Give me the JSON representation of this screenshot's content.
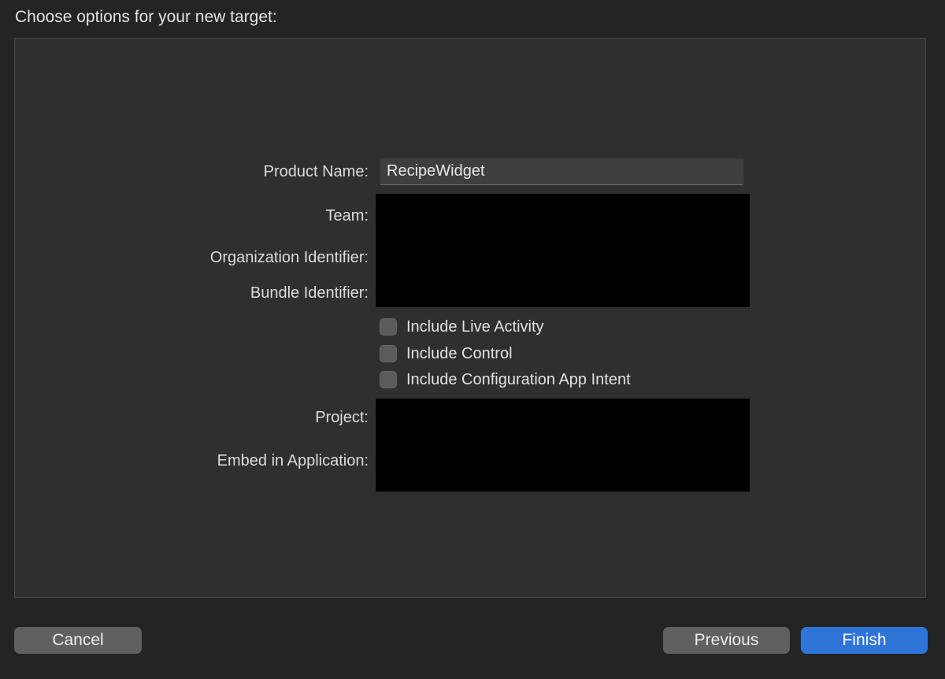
{
  "dialog": {
    "title": "Choose options for your new target:"
  },
  "form": {
    "product_name_label": "Product Name:",
    "product_name_value": "RecipeWidget",
    "team_label": "Team:",
    "organization_identifier_label": "Organization Identifier:",
    "bundle_identifier_label": "Bundle Identifier:",
    "project_label": "Project:",
    "embed_in_application_label": "Embed in Application:"
  },
  "options": [
    {
      "label": "Include Live Activity",
      "checked": false
    },
    {
      "label": "Include Control",
      "checked": false
    },
    {
      "label": "Include Configuration App Intent",
      "checked": false
    }
  ],
  "buttons": {
    "cancel": "Cancel",
    "previous": "Previous",
    "finish": "Finish"
  },
  "colors": {
    "window_background": "#242424",
    "panel_background": "#2f2f2f",
    "primary_button": "#2f75d8",
    "secondary_button": "#606060",
    "redaction": "#000000"
  }
}
